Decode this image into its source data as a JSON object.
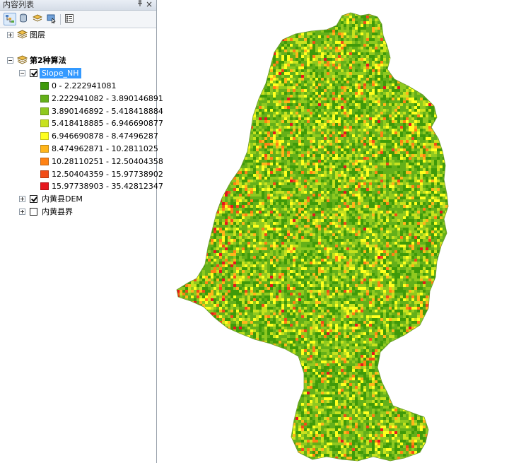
{
  "toc": {
    "title": "内容列表",
    "pin_glyph": "ᵖ",
    "close_glyph": "×",
    "toolbar": [
      {
        "name": "list-by-drawing-order-icon",
        "active": true
      },
      {
        "name": "list-by-source-icon",
        "active": false
      },
      {
        "name": "list-by-visibility-icon",
        "active": false
      },
      {
        "name": "list-by-selection-icon",
        "active": false
      },
      {
        "name": "options-icon",
        "active": false
      }
    ],
    "layers_group": {
      "label": "图层"
    },
    "algo_group": {
      "label": "第2种算法"
    },
    "slope_layer": {
      "label": "Slope_NH",
      "checked": true
    },
    "legend": [
      {
        "label": "0 - 2.222941081",
        "color": "#3f9a0a"
      },
      {
        "label": "2.222941082 - 3.890146891",
        "color": "#64b01a"
      },
      {
        "label": "3.890146892 - 5.418418884",
        "color": "#8fc91f"
      },
      {
        "label": "5.418418885 - 6.946690877",
        "color": "#c8e21e"
      },
      {
        "label": "6.946690878 - 8.47496287",
        "color": "#ffff1e"
      },
      {
        "label": "8.474962871 - 10.2811025",
        "color": "#ffb51a"
      },
      {
        "label": "10.28110251 - 12.50404358",
        "color": "#ff8214"
      },
      {
        "label": "12.50404359 - 15.97738902",
        "color": "#f24d18"
      },
      {
        "label": "15.97738903 - 35.42812347",
        "color": "#e6171d"
      }
    ],
    "dem_layer": {
      "label": "内黄县DEM",
      "checked": true
    },
    "boundary_layer": {
      "label": "内黄县界",
      "checked": false
    }
  }
}
